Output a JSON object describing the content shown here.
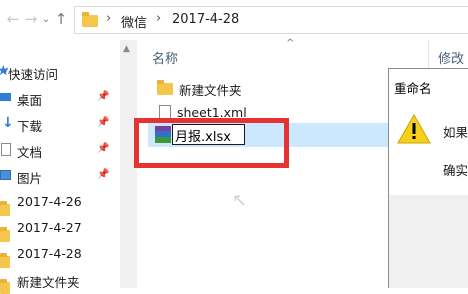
{
  "toolbar": {
    "crumbs": [
      "微信",
      "2017-4-28"
    ]
  },
  "columns": {
    "name": "名称",
    "modified": "修改"
  },
  "nav": {
    "quick_access": "快速访问",
    "items": [
      {
        "label": "桌面",
        "icon": "desktop-icon",
        "pinned": true
      },
      {
        "label": "下载",
        "icon": "download-icon",
        "pinned": true
      },
      {
        "label": "文档",
        "icon": "document-icon",
        "pinned": true
      },
      {
        "label": "图片",
        "icon": "picture-icon",
        "pinned": true
      },
      {
        "label": "2017-4-26",
        "icon": "folder-icon",
        "pinned": false
      },
      {
        "label": "2017-4-27",
        "icon": "folder-icon",
        "pinned": false
      },
      {
        "label": "2017-4-28",
        "icon": "folder-icon",
        "pinned": false
      },
      {
        "label": "新建文件夹",
        "icon": "folder-icon",
        "pinned": false
      }
    ]
  },
  "files": [
    {
      "name": "新建文件夹",
      "icon": "folder-icon"
    },
    {
      "name": "sheet1.xml",
      "icon": "xml-file-icon"
    }
  ],
  "rename": {
    "value": "月报.xlsx",
    "icon": "winrar-archive-icon"
  },
  "dialog": {
    "title": "重命名",
    "line1": "如果",
    "line2": "确实",
    "icon": "warning-icon"
  },
  "colors": {
    "highlight": "#e53232",
    "selection": "#cce8ff",
    "folder": "#f5c64c",
    "warning": "#f7d117"
  }
}
